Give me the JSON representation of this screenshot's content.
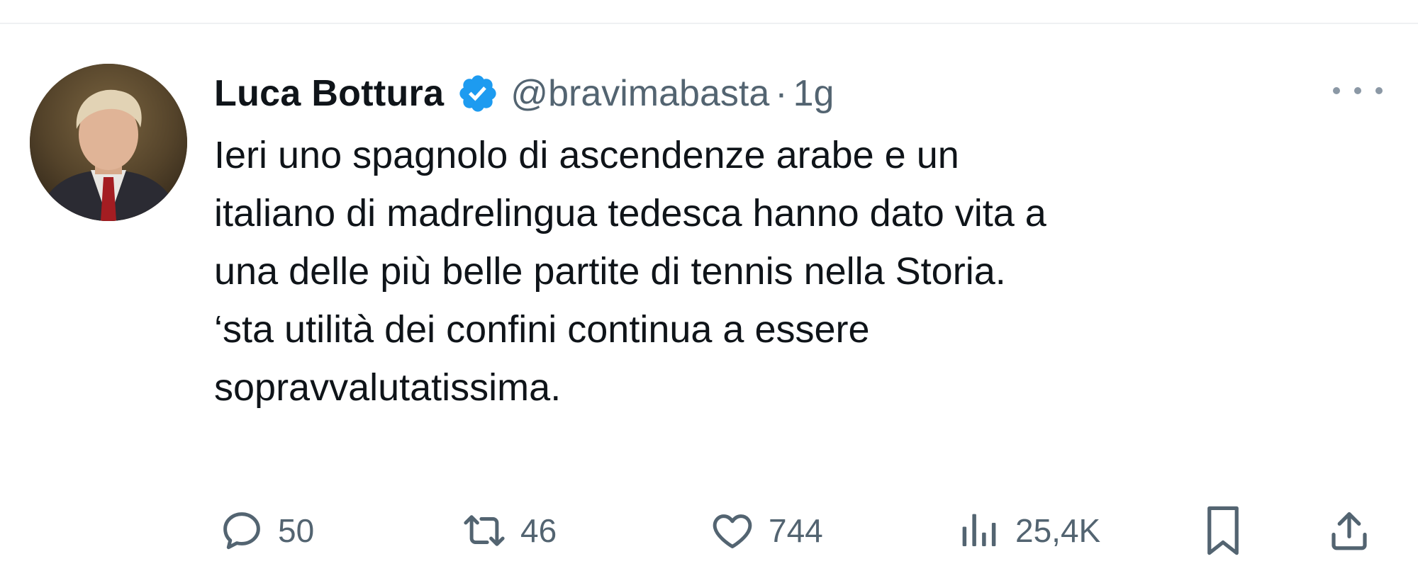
{
  "tweet": {
    "author": {
      "name": "Luca Bottura",
      "handle": "@bravimabasta",
      "verified": true
    },
    "separator": "·",
    "time": "1g",
    "text_lines": [
      "Ieri uno spagnolo di ascendenze arabe e un",
      "italiano di madrelingua tedesca hanno dato vita a",
      "una delle più belle partite di tennis nella Storia.",
      "‘sta utilità dei confini continua a essere",
      "sopravvalutatissima."
    ],
    "actions": {
      "reply": {
        "icon": "reply-icon",
        "count": "50"
      },
      "retweet": {
        "icon": "retweet-icon",
        "count": "46"
      },
      "like": {
        "icon": "heart-icon",
        "count": "744"
      },
      "views": {
        "icon": "views-chart-icon",
        "count": "25,4K"
      },
      "bookmark": {
        "icon": "bookmark-icon"
      },
      "share": {
        "icon": "share-icon"
      }
    },
    "more_icon": "more-dots-icon"
  },
  "colors": {
    "text_primary": "#0f1419",
    "text_secondary": "#536471",
    "verified_blue": "#1d9bf0",
    "divider": "#eff1f3"
  }
}
